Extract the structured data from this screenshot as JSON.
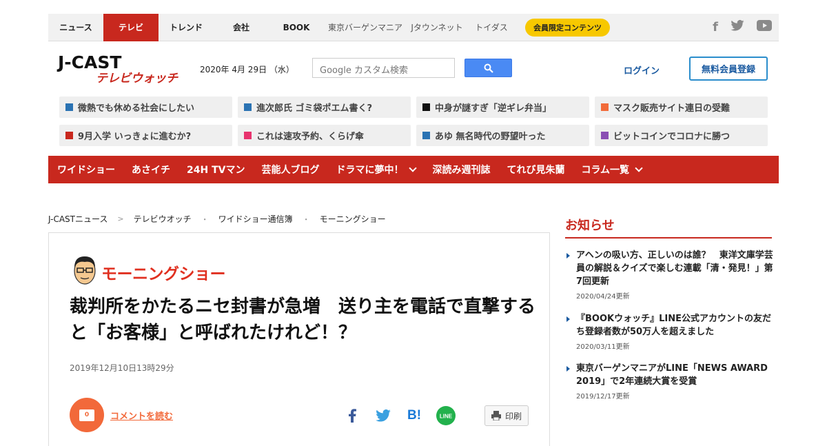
{
  "topnav": {
    "items": [
      "ニュース",
      "テレビ",
      "トレンド",
      "会社",
      "BOOK",
      "東京バーゲンマニア",
      "Jタウンネット",
      "トイダス"
    ],
    "member_label": "会員限定コンテンツ",
    "social_icons": [
      "facebook-icon",
      "twitter-icon",
      "youtube-icon"
    ]
  },
  "header": {
    "logo_main": "J-CAST",
    "logo_sub": "テレビウォッチ",
    "date": "2020年 4月 29日 （水）",
    "search_placeholder": "Google カスタム検索",
    "login": "ログイン",
    "register": "無料会員登録"
  },
  "trending": [
    {
      "label": "微熱でも休める社会にしたい",
      "color": "#2b73b3"
    },
    {
      "label": "進次郎氏 ゴミ袋ポエム書く?",
      "color": "#2b73b3"
    },
    {
      "label": "中身が謎すぎ「逆ギレ弁当」",
      "color": "#111111"
    },
    {
      "label": "マスク販売サイト連日の受難",
      "color": "#f26b3a"
    },
    {
      "label": "9月入学 いっきょに進むか?",
      "color": "#c8281e"
    },
    {
      "label": "これは速攻予約、くらげ傘",
      "color": "#e8336e"
    },
    {
      "label": "あゆ 無名時代の野望叶った",
      "color": "#2b73b3"
    },
    {
      "label": "ビットコインでコロナに勝つ",
      "color": "#8a4fb3"
    }
  ],
  "rednav": [
    {
      "label": "ワイドショー",
      "dropdown": false
    },
    {
      "label": "あさイチ",
      "dropdown": false
    },
    {
      "label": "24H TVマン",
      "dropdown": false
    },
    {
      "label": "芸能人ブログ",
      "dropdown": false
    },
    {
      "label": "ドラマに夢中！",
      "dropdown": true
    },
    {
      "label": "深読み週刊誌",
      "dropdown": false
    },
    {
      "label": "てれび見朱蘭",
      "dropdown": false
    },
    {
      "label": "コラム一覧",
      "dropdown": true
    }
  ],
  "breadcrumb": [
    "J-CASTニュース",
    "テレビウオッチ",
    "ワイドショー通信簿",
    "モーニングショー"
  ],
  "article": {
    "show_name": "モーニングショー",
    "headline": "裁判所をかたるニセ封書が急増　送り主を電話で直撃すると「お客様」と呼ばれたけれど！？",
    "published": "2019年12月10日13時29分",
    "comment_count": "0",
    "comment_link": "コメントを読む",
    "print": "印刷",
    "share_icons": [
      "facebook-icon",
      "twitter-icon",
      "hatena-icon",
      "line-icon"
    ]
  },
  "notices": {
    "title": "お知らせ",
    "items": [
      {
        "text": "アヘンの吸い方、正しいのは誰？　東洋文庫学芸員の解説＆クイズで楽しむ連載「清・発見！」第7回更新",
        "date": "2020/04/24更新"
      },
      {
        "text": "『BOOKウォッチ』LINE公式アカウントの友だち登録者数が50万人を超えました",
        "date": "2020/03/11更新"
      },
      {
        "text": "東京バーゲンマニアがLINE「NEWS AWARD 2019」で2年連続大賞を受賞",
        "date": "2019/12/17更新"
      }
    ]
  }
}
